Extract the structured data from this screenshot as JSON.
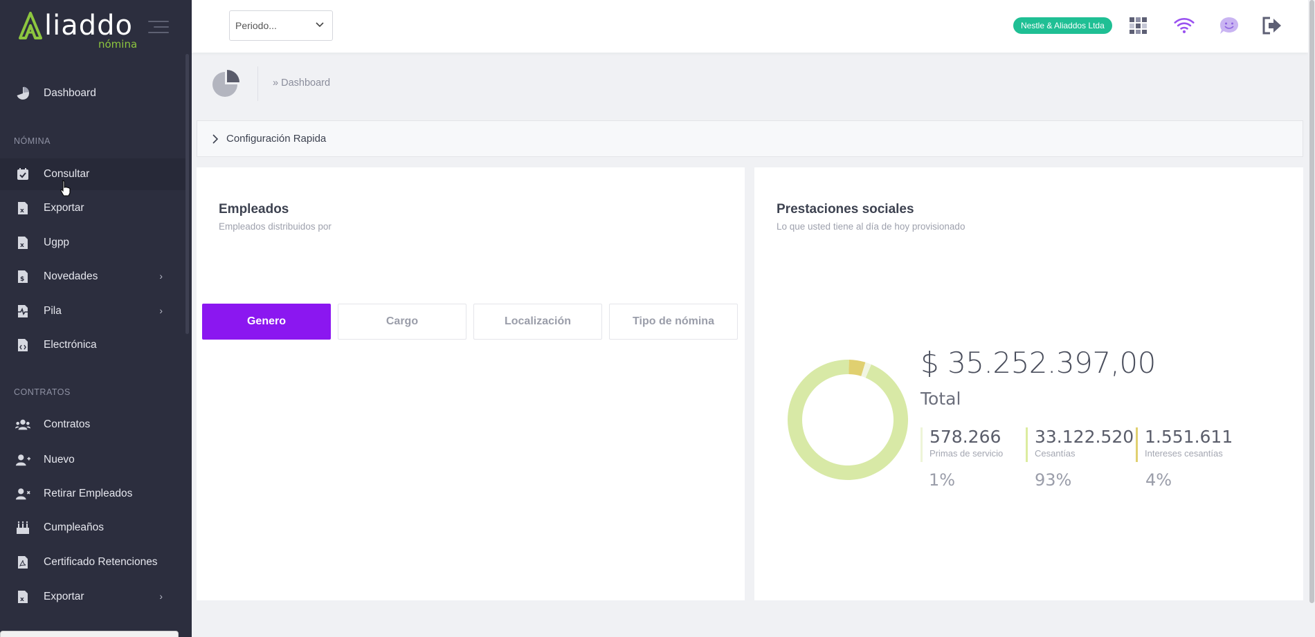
{
  "brand": {
    "name": "liaddo",
    "sub": "nómina"
  },
  "sidebar": {
    "items_top": [
      {
        "label": "Dashboard",
        "icon": "pie-chart-icon"
      }
    ],
    "section_nomina": "NÓMINA",
    "items_nomina": [
      {
        "label": "Consultar",
        "icon": "calendar-check-icon"
      },
      {
        "label": "Exportar",
        "icon": "excel-file-icon"
      },
      {
        "label": "Ugpp",
        "icon": "excel-file-icon"
      },
      {
        "label": "Novedades",
        "icon": "money-file-icon",
        "arrow": "›"
      },
      {
        "label": "Pila",
        "icon": "pulse-file-icon",
        "arrow": "›"
      },
      {
        "label": "Electrónica",
        "icon": "code-file-icon"
      }
    ],
    "section_contratos": "CONTRATOS",
    "items_contratos": [
      {
        "label": "Contratos",
        "icon": "users-icon"
      },
      {
        "label": "Nuevo",
        "icon": "user-plus-icon"
      },
      {
        "label": "Retirar Empleados",
        "icon": "user-times-icon"
      },
      {
        "label": "Cumpleaños",
        "icon": "birthday-cake-icon"
      },
      {
        "label": "Certificado Retenciones",
        "icon": "pdf-file-icon"
      },
      {
        "label": "Exportar",
        "icon": "excel-file-icon",
        "arrow": "›"
      }
    ]
  },
  "topbar": {
    "period_placeholder": "Periodo...",
    "company": "Nestle & Aliaddos Ltda",
    "icons": [
      "apps-grid-icon",
      "wifi-icon",
      "chat-smile-icon",
      "logout-icon"
    ]
  },
  "breadcrumb": "» Dashboard",
  "quick_config": "Configuración Rapida",
  "empleados": {
    "title": "Empleados",
    "subtitle": "Empleados distribuidos por",
    "tabs": [
      "Genero",
      "Cargo",
      "Localización",
      "Tipo de nómina"
    ],
    "active_tab": 0
  },
  "prestaciones": {
    "title": "Prestaciones sociales",
    "subtitle": "Lo que usted tiene al día de hoy provisionado",
    "total_value": "$ 35.252.397,00",
    "total_label": "Total",
    "stats": [
      {
        "value": "578.266",
        "label": "Primas de servicio",
        "pct": "1%",
        "color": "#eef5d8"
      },
      {
        "value": "33.122.520",
        "label": "Cesantías",
        "pct": "93%",
        "color": "#dcec9f"
      },
      {
        "value": "1.551.611",
        "label": "Intereses cesantías",
        "pct": "4%",
        "color": "#e0d070"
      }
    ]
  },
  "chart_data": {
    "type": "pie",
    "categories": [
      "Primas de servicio",
      "Cesantías",
      "Intereses cesantías"
    ],
    "values": [
      578266,
      33122520,
      1551611
    ],
    "colors": [
      "#f1f5e2",
      "#d8e9a6",
      "#e0d070"
    ]
  },
  "colors": {
    "accent": "#8b17f0",
    "badge": "#1fbf94",
    "sidebar": "#2c2e3e",
    "brand_green": "#8dc63f"
  }
}
